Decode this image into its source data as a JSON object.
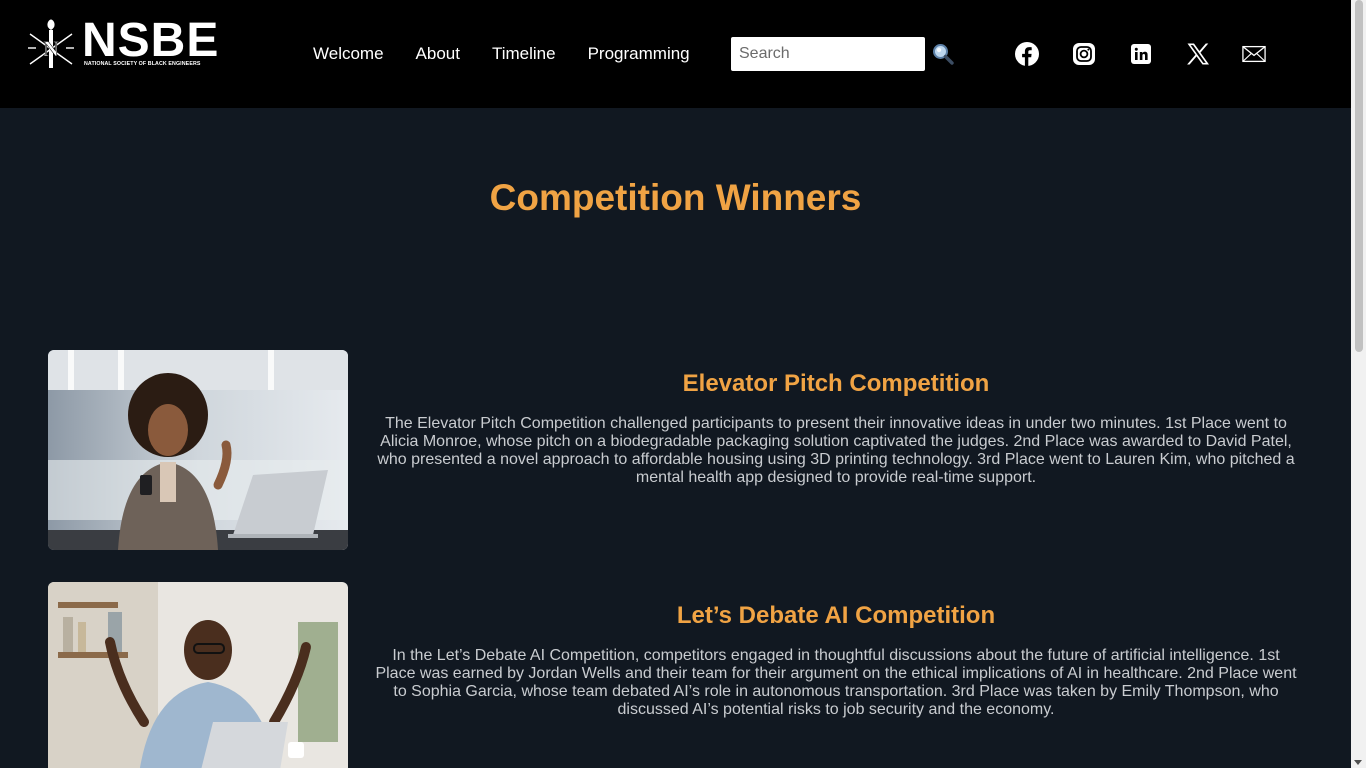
{
  "brand": {
    "name": "NSBE",
    "tagline": "NATIONAL SOCIETY OF BLACK ENGINEERS",
    "emblem_letter": "N"
  },
  "nav": {
    "items": [
      {
        "label": "Welcome"
      },
      {
        "label": "About"
      },
      {
        "label": "Timeline"
      },
      {
        "label": "Programming"
      }
    ]
  },
  "search": {
    "placeholder": "Search",
    "icon": "magnifier-icon"
  },
  "social": [
    {
      "name": "facebook-icon"
    },
    {
      "name": "instagram-icon"
    },
    {
      "name": "linkedin-icon"
    },
    {
      "name": "x-icon"
    },
    {
      "name": "mail-icon"
    }
  ],
  "page": {
    "title": "Competition Winners"
  },
  "cards": [
    {
      "title": "Elevator Pitch Competition",
      "text": "The Elevator Pitch Competition challenged participants to present their innovative ideas in under two minutes. 1st Place went to Alicia Monroe, whose pitch on a biodegradable packaging solution captivated the judges. 2nd Place was awarded to David Patel, who presented a novel approach to affordable housing using 3D printing technology. 3rd Place went to Lauren Kim, who pitched a mental health app designed to provide real-time support."
    },
    {
      "title": "Let’s Debate AI Competition",
      "text": "In the Let’s Debate AI Competition, competitors engaged in thoughtful discussions about the future of artificial intelligence. 1st Place was earned by Jordan Wells and their team for their argument on the ethical implications of AI in healthcare. 2nd Place went to Sophia Garcia, whose team debated AI’s role in autonomous transportation. 3rd Place was taken by Emily Thompson, who discussed AI’s potential risks to job security and the economy."
    }
  ],
  "colors": {
    "accent": "#f0a344",
    "background": "#111821",
    "header": "#000000"
  }
}
